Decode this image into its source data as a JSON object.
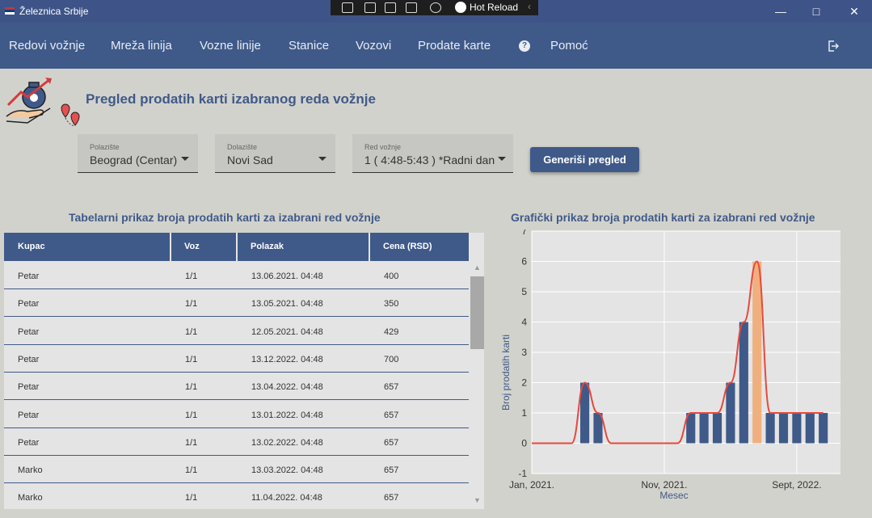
{
  "window": {
    "title": "Železnica Srbije"
  },
  "devbar": {
    "hot_reload": "Hot Reload"
  },
  "nav": {
    "items": [
      "Redovi vožnje",
      "Mreža linija",
      "Vozne linije",
      "Stanice",
      "Vozovi",
      "Prodate karte",
      "Pomoć"
    ]
  },
  "page": {
    "title": "Pregled prodatih karti izabranog reda vožnje"
  },
  "filters": {
    "from": {
      "label": "Polazište",
      "value": "Beograd (Centar)"
    },
    "to": {
      "label": "Dolazište",
      "value": "Novi Sad"
    },
    "schedule": {
      "label": "Red vožnje",
      "value": "1 ( 4:48-5:43 ) *Radni dan"
    },
    "generate_label": "Generiši pregled"
  },
  "table": {
    "title": "Tabelarni prikaz broja prodatih karti za izabrani red vožnje",
    "columns": [
      "Kupac",
      "Voz",
      "Polazak",
      "Cena (RSD)"
    ],
    "rows": [
      [
        "Petar",
        "1/1",
        "13.06.2021. 04:48",
        "400"
      ],
      [
        "Petar",
        "1/1",
        "13.05.2021. 04:48",
        "350"
      ],
      [
        "Petar",
        "1/1",
        "12.05.2021. 04:48",
        "429"
      ],
      [
        "Petar",
        "1/1",
        "13.12.2022. 04:48",
        "700"
      ],
      [
        "Petar",
        "1/1",
        "13.04.2022. 04:48",
        "657"
      ],
      [
        "Petar",
        "1/1",
        "13.01.2022. 04:48",
        "657"
      ],
      [
        "Petar",
        "1/1",
        "13.02.2022. 04:48",
        "657"
      ],
      [
        "Marko",
        "1/1",
        "13.03.2022. 04:48",
        "657"
      ],
      [
        "Marko",
        "1/1",
        "11.04.2022. 04:48",
        "657"
      ]
    ]
  },
  "chart_data": {
    "type": "bar",
    "title": "Grafički prikaz broja prodatih karti za izabrani red vožnje",
    "xlabel": "Mesec",
    "ylabel": "Broj prodatih karti",
    "ylim": [
      -1,
      7
    ],
    "yticks": [
      -1,
      0,
      1,
      2,
      3,
      4,
      5,
      6,
      7
    ],
    "xtick_labels": [
      {
        "label": "Jan, 2021.",
        "month": 0
      },
      {
        "label": "Nov, 2021.",
        "month": 10
      },
      {
        "label": "Sept, 2022.",
        "month": 20
      }
    ],
    "xlim": [
      0,
      23.3
    ],
    "bars": [
      {
        "month": 4,
        "value": 2
      },
      {
        "month": 5,
        "value": 1
      },
      {
        "month": 12,
        "value": 1
      },
      {
        "month": 13,
        "value": 1
      },
      {
        "month": 14,
        "value": 1
      },
      {
        "month": 15,
        "value": 2
      },
      {
        "month": 16,
        "value": 4
      },
      {
        "month": 17,
        "value": 6,
        "highlight": true
      },
      {
        "month": 18,
        "value": 1
      },
      {
        "month": 19,
        "value": 1
      },
      {
        "month": 20,
        "value": 1
      },
      {
        "month": 21,
        "value": 1
      },
      {
        "month": 22,
        "value": 1
      }
    ],
    "grid": true,
    "colors": {
      "bar": "#3f5a89",
      "highlight": "#f0b07e",
      "line": "#e8483d"
    }
  }
}
